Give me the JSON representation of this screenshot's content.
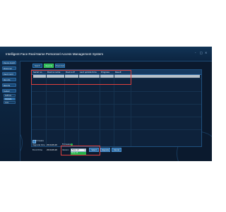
{
  "window": {
    "title": "Intelligent Face Real-Name Personnel Access Management System",
    "controls": [
      "-",
      "□",
      "×"
    ]
  },
  "sidebar": {
    "items": [
      {
        "label": "Device mgmt"
      },
      {
        "label": "Personnel"
      },
      {
        "label": "Dept mgmt"
      },
      {
        "label": "Records"
      },
      {
        "label": "Reports"
      },
      {
        "label": "System"
      }
    ],
    "subitems": [
      {
        "label": "Settings"
      },
      {
        "label": "Upgrade"
      },
      {
        "label": "Logs"
      }
    ]
  },
  "toolbar": {
    "tabs": [
      {
        "label": "Search"
      },
      {
        "label": "Upgrade"
      },
      {
        "label": "Download"
      }
    ]
  },
  "table": {
    "columns": [
      "Serial no.",
      "Device name",
      "Device IP",
      "Last update time",
      "Progress",
      "Result"
    ],
    "rows": [
      [
        "",
        "",
        "",
        "",
        "",
        ""
      ]
    ]
  },
  "footer": {
    "firmware_label": "Firmware",
    "upgrade_label": "Upgrade time",
    "upgrade_value": "2019-08-20",
    "enroll_label": "Enroll time",
    "enroll_value": "2019-08-20",
    "firmware2_label": "Firmware",
    "version_label": "Version",
    "select_value": "Face v5",
    "select_option": "Face v5",
    "buttons": [
      "Select",
      "Upgrade",
      "Cancel"
    ]
  },
  "colors": {
    "background": "#0b1a2e",
    "accent_green": "#23b34a",
    "highlight_red": "#e0403d",
    "selected_row": "#b8c3cc"
  }
}
